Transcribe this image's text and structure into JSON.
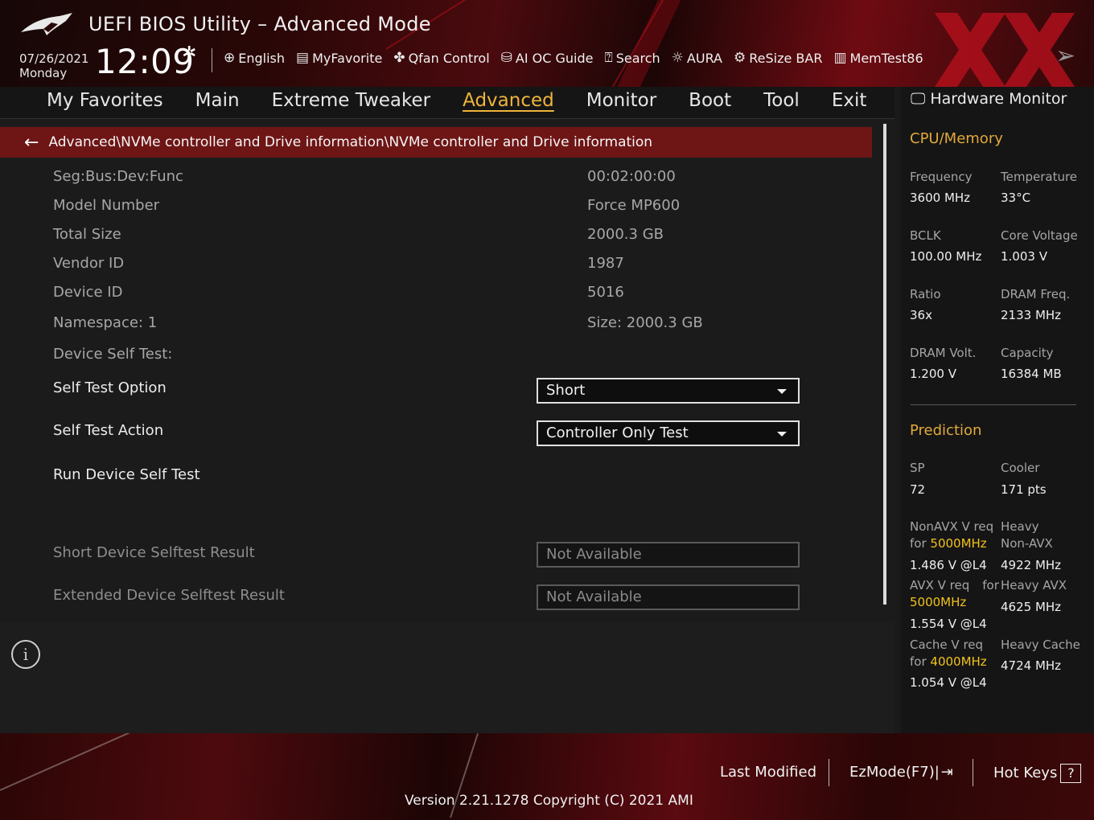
{
  "header": {
    "title": "UEFI BIOS Utility – Advanced Mode",
    "date": "07/26/2021",
    "day": "Monday",
    "time": "12:09",
    "toolbar": [
      {
        "label": "English",
        "icon": "globe-icon"
      },
      {
        "label": "MyFavorite",
        "icon": "favorite-icon"
      },
      {
        "label": "Qfan Control",
        "icon": "fan-icon"
      },
      {
        "label": "AI OC Guide",
        "icon": "chip-icon"
      },
      {
        "label": "Search",
        "icon": "search-icon"
      },
      {
        "label": "AURA",
        "icon": "aura-icon"
      },
      {
        "label": "ReSize BAR",
        "icon": "resize-bar-icon"
      },
      {
        "label": "MemTest86",
        "icon": "memory-icon"
      }
    ]
  },
  "nav": {
    "tabs": [
      "My Favorites",
      "Main",
      "Extreme Tweaker",
      "Advanced",
      "Monitor",
      "Boot",
      "Tool",
      "Exit"
    ],
    "active": "Advanced"
  },
  "main": {
    "breadcrumb": "Advanced\\NVMe controller and Drive information\\NVMe controller and Drive information",
    "info_rows": [
      {
        "label": "Seg:Bus:Dev:Func",
        "value": "00:02:00:00"
      },
      {
        "label": "Model Number",
        "value": "Force MP600"
      },
      {
        "label": "Total Size",
        "value": "2000.3 GB"
      },
      {
        "label": "Vendor ID",
        "value": "1987"
      },
      {
        "label": "Device ID",
        "value": "5016"
      },
      {
        "label": "Namespace: 1",
        "value": "Size: 2000.3 GB"
      }
    ],
    "self_test_header": "Device Self Test:",
    "self_test_option": {
      "label": "Self Test Option",
      "value": "Short"
    },
    "self_test_action": {
      "label": "Self Test Action",
      "value": "Controller Only Test"
    },
    "run_test": "Run Device Self Test",
    "short_result": {
      "label": "Short Device Selftest Result",
      "value": "Not Available"
    },
    "extended_result": {
      "label": "Extended Device Selftest Result",
      "value": "Not Available"
    }
  },
  "hw_monitor": {
    "title": "Hardware Monitor",
    "cpu_memory": {
      "heading": "CPU/Memory",
      "frequency": {
        "label": "Frequency",
        "value": "3600 MHz"
      },
      "temperature": {
        "label": "Temperature",
        "value": "33°C"
      },
      "bclk": {
        "label": "BCLK",
        "value": "100.00 MHz"
      },
      "core_voltage": {
        "label": "Core Voltage",
        "value": "1.003 V"
      },
      "ratio": {
        "label": "Ratio",
        "value": "36x"
      },
      "dram_freq": {
        "label": "DRAM Freq.",
        "value": "2133 MHz"
      },
      "dram_volt": {
        "label": "DRAM Volt.",
        "value": "1.200 V"
      },
      "capacity": {
        "label": "Capacity",
        "value": "16384 MB"
      }
    },
    "prediction": {
      "heading": "Prediction",
      "sp": {
        "label": "SP",
        "value": "72"
      },
      "cooler": {
        "label": "Cooler",
        "value": "171 pts"
      },
      "nonavx": {
        "label1": "NonAVX V req",
        "label2_prefix": "for",
        "label2_freq": "5000MHz",
        "value": "1.486 V @L4"
      },
      "heavy_nonavx": {
        "label1": "Heavy",
        "label2": "Non-AVX",
        "value": "4922 MHz"
      },
      "avx": {
        "label1": "AVX V req",
        "label1_suffix": "for",
        "label2_freq": "5000MHz",
        "value": "1.554 V @L4"
      },
      "heavy_avx": {
        "label": "Heavy AVX",
        "value": "4625 MHz"
      },
      "cache": {
        "label1": "Cache V req",
        "label2_prefix": "for",
        "label2_freq": "4000MHz",
        "value": "1.054 V @L4"
      },
      "heavy_cache": {
        "label": "Heavy Cache",
        "value": "4724 MHz"
      }
    }
  },
  "footer": {
    "last_modified": "Last Modified",
    "ezmode": "EzMode(F7)|",
    "hotkeys": "Hot Keys",
    "version": "Version 2.21.1278 Copyright (C) 2021 AMI"
  },
  "colors": {
    "accent": "#e1a93b",
    "highlight": "#f2c21b",
    "breadcrumb_bg": "#6e1515",
    "brand_red": "#b0101c"
  }
}
